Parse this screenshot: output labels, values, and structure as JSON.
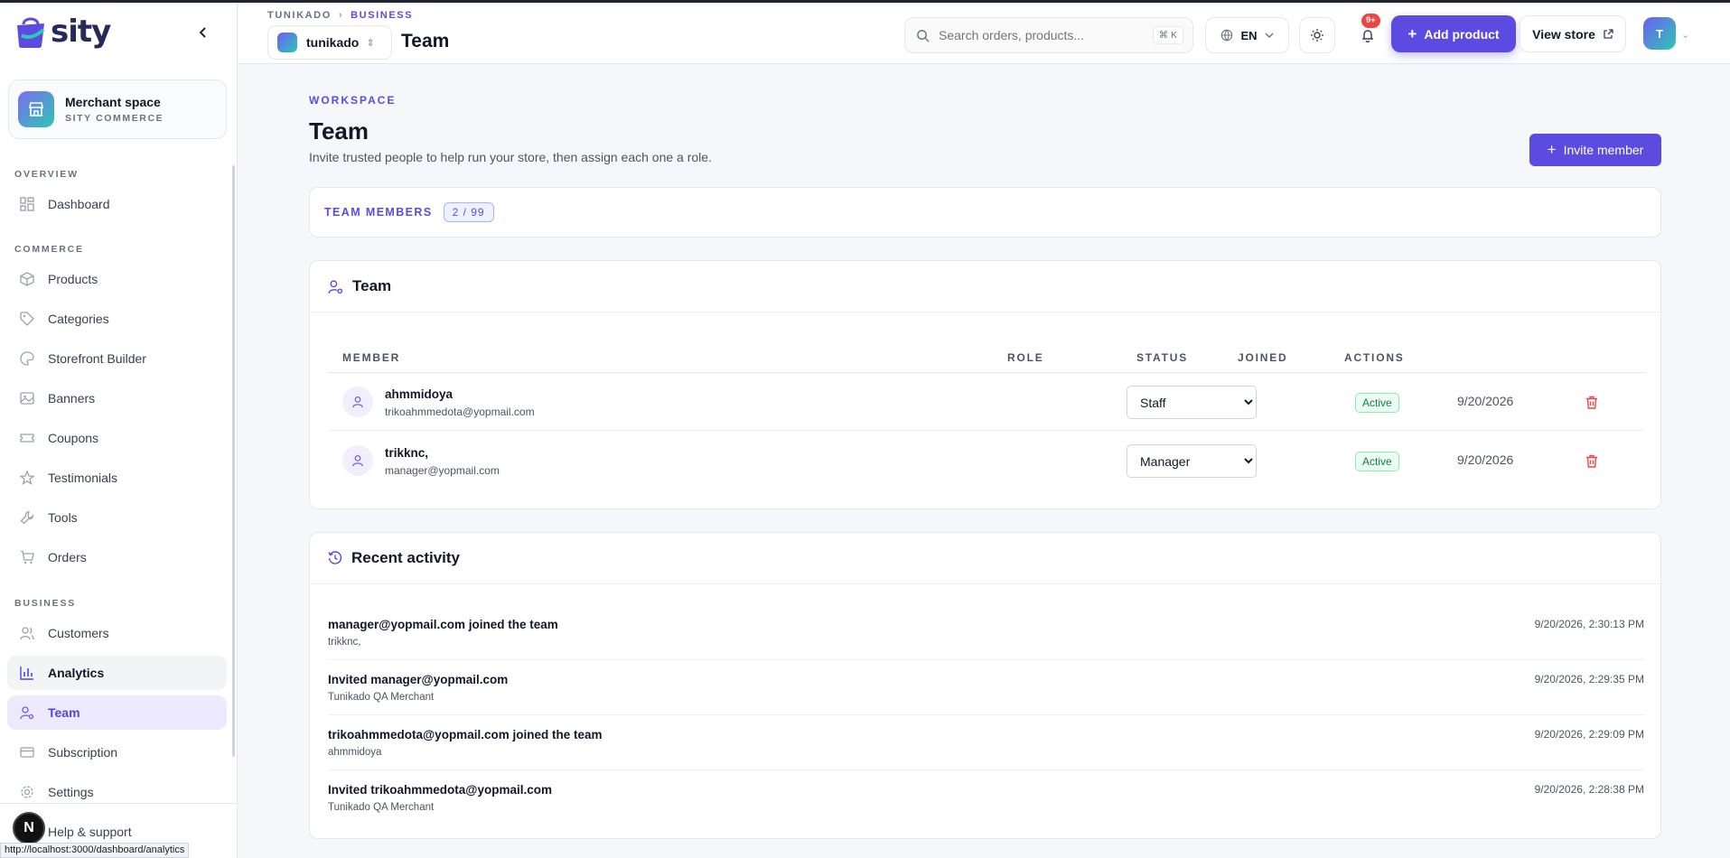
{
  "brand": {
    "name": "sity"
  },
  "sidebar": {
    "merchant_title": "Merchant space",
    "merchant_sub": "SITY COMMERCE",
    "sections": [
      "OVERVIEW",
      "COMMERCE",
      "BUSINESS"
    ],
    "items": [
      {
        "label": "Dashboard",
        "icon": "dashboard-icon"
      },
      {
        "label": "Products",
        "icon": "box-icon"
      },
      {
        "label": "Categories",
        "icon": "tag-icon"
      },
      {
        "label": "Storefront Builder",
        "icon": "palette-icon"
      },
      {
        "label": "Banners",
        "icon": "image-icon"
      },
      {
        "label": "Coupons",
        "icon": "ticket-icon"
      },
      {
        "label": "Testimonials",
        "icon": "star-icon"
      },
      {
        "label": "Tools",
        "icon": "wrench-icon"
      },
      {
        "label": "Orders",
        "icon": "cart-icon"
      },
      {
        "label": "Customers",
        "icon": "users-icon"
      },
      {
        "label": "Analytics",
        "icon": "bar-chart-icon"
      },
      {
        "label": "Team",
        "icon": "user-cog-icon"
      },
      {
        "label": "Subscription",
        "icon": "card-icon"
      },
      {
        "label": "Settings",
        "icon": "gear-icon"
      },
      {
        "label": "Help & support",
        "icon": "help-icon"
      }
    ],
    "active": "Team",
    "hover": "Analytics",
    "next_badge": "N"
  },
  "status_url": "http://localhost:3000/dashboard/analytics",
  "header": {
    "crumb_root": "TUNIKADO",
    "crumb_current": "BUSINESS",
    "store_name": "tunikado",
    "title": "Team",
    "search_placeholder": "Search orders, products...",
    "search_kbd": "⌘ K",
    "language": "EN",
    "notif_count": "9+",
    "add_product": "Add product",
    "view_store": "View store",
    "avatar_initial": "T"
  },
  "page": {
    "eyebrow": "WORKSPACE",
    "title": "Team",
    "description": "Invite trusted people to help run your store, then assign each one a role.",
    "invite_button": "Invite member"
  },
  "members_summary": {
    "label": "TEAM MEMBERS",
    "count": "2 / 99"
  },
  "team_table": {
    "title": "Team",
    "columns": [
      "MEMBER",
      "ROLE",
      "STATUS",
      "JOINED",
      "ACTIONS"
    ],
    "rows": [
      {
        "name": "ahmmidoya",
        "email": "trikoahmmedota@yopmail.com",
        "role": "Staff",
        "status": "Active",
        "joined": "9/20/2026"
      },
      {
        "name": "trikknc,",
        "email": "manager@yopmail.com",
        "role": "Manager",
        "status": "Active",
        "joined": "9/20/2026"
      }
    ]
  },
  "activity": {
    "title": "Recent activity",
    "items": [
      {
        "title": "manager@yopmail.com joined the team",
        "sub": "trikknc,",
        "time": "9/20/2026, 2:30:13 PM"
      },
      {
        "title": "Invited manager@yopmail.com",
        "sub": "Tunikado QA Merchant",
        "time": "9/20/2026, 2:29:35 PM"
      },
      {
        "title": "trikoahmmedota@yopmail.com joined the team",
        "sub": "ahmmidoya",
        "time": "9/20/2026, 2:29:09 PM"
      },
      {
        "title": "Invited trikoahmmedota@yopmail.com",
        "sub": "Tunikado QA Merchant",
        "time": "9/20/2026, 2:28:38 PM"
      }
    ]
  },
  "colors": {
    "accent": "#5b4be0",
    "success": "#15803d",
    "danger": "#ef4444"
  }
}
